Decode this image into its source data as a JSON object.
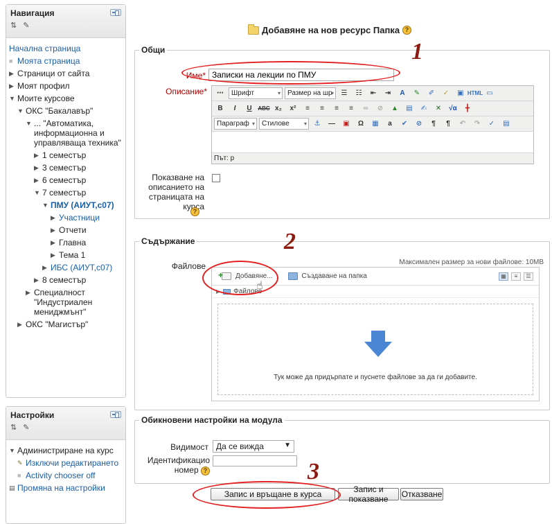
{
  "nav": {
    "title": "Навигация",
    "items": [
      {
        "label": "Начална страница",
        "marker": "none",
        "link": true
      },
      {
        "label": "Моята страница",
        "marker": "bullet",
        "link": true
      },
      {
        "label": "Страници от сайта",
        "marker": "right",
        "link": false
      },
      {
        "label": "Моят профил",
        "marker": "right",
        "link": false
      },
      {
        "label": "Моите курсове",
        "marker": "down",
        "link": false
      },
      {
        "label": "ОКС \"Бакалавър\"",
        "marker": "down",
        "link": false
      },
      {
        "label": "... \"Автоматика, информационна и управляваща техника\"",
        "marker": "down",
        "link": false
      },
      {
        "label": "1 семестър",
        "marker": "right",
        "link": false
      },
      {
        "label": "3 семестър",
        "marker": "right",
        "link": false
      },
      {
        "label": "6 семестър",
        "marker": "right",
        "link": false
      },
      {
        "label": "7 семестър",
        "marker": "down",
        "link": false
      },
      {
        "label": "ПМУ (АИУТ,с07)",
        "marker": "down",
        "link": true
      },
      {
        "label": "Участници",
        "marker": "right",
        "link": true
      },
      {
        "label": "Отчети",
        "marker": "right",
        "link": false
      },
      {
        "label": "Главна",
        "marker": "right",
        "link": false
      },
      {
        "label": "Тема 1",
        "marker": "right",
        "link": false
      },
      {
        "label": "ИБС (АИУТ,с07)",
        "marker": "right",
        "link": true
      },
      {
        "label": "8 семестър",
        "marker": "right",
        "link": false
      },
      {
        "label": "Специалност \"Индустриален мениджмънт\"",
        "marker": "right",
        "link": false
      },
      {
        "label": "ОКС \"Магистър\"",
        "marker": "right",
        "link": false
      }
    ]
  },
  "settings": {
    "title": "Настройки",
    "admin_label": "Администриране на курс",
    "items": [
      {
        "label": "Изключи редактирането",
        "icon": "pencil-icon"
      },
      {
        "label": "Activity chooser off",
        "icon": "bullet"
      },
      {
        "label": "Промяна на настройки",
        "icon": "document-icon"
      }
    ]
  },
  "page_title": "Добавяне на нов ресурс Папка",
  "general": {
    "legend": "Общи",
    "name_label": "Име",
    "name_value": "Записки на лекции по ПМУ",
    "description_label": "Описание",
    "editor": {
      "font_select": "Шрифт",
      "size_select": "Размер на шр",
      "paragraph_select": "Параграф",
      "styles_select": "Стилове",
      "status_path": "Път: p"
    },
    "show_description_label": "Показване на описанието на страницата на курса"
  },
  "content": {
    "legend": "Съдържание",
    "files_label": "Файлове",
    "max_size": "Максимален размер за нови файлове: 10MB",
    "add_button": "Добавяне...",
    "create_folder_button": "Създаване на папка",
    "path_folder": "Файлове",
    "drop_text": "Тук може да придърпате и пуснете файлове за да ги добавите."
  },
  "common": {
    "legend": "Обикновени настройки на модула",
    "visibility_label": "Видимост",
    "visibility_value": "Да се вижда",
    "id_label_line1": "Идентификацио",
    "id_label_line2": "номер"
  },
  "buttons": {
    "save_return": "Запис и връщане в курса",
    "save_display": "Запис и показване",
    "cancel": "Отказване"
  },
  "annotations": {
    "step1": "1",
    "step2": "2",
    "step3": "3"
  },
  "colors": {
    "link": "#1a5ea8",
    "required": "#aa0000",
    "annotation": "#e32020"
  }
}
